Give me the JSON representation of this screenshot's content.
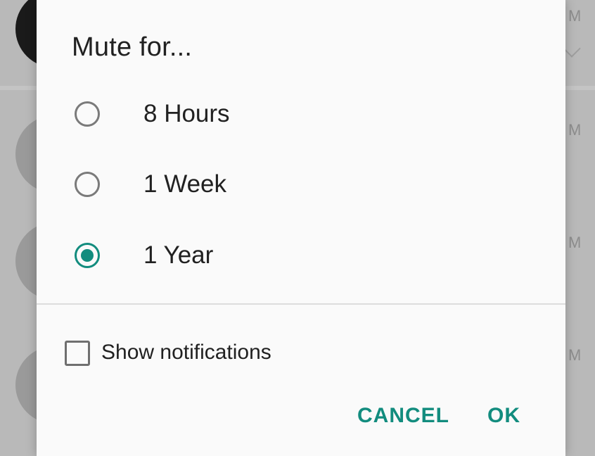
{
  "background": {
    "time_fragments": [
      "M",
      "M",
      "M",
      "M"
    ]
  },
  "dialog": {
    "title": "Mute for...",
    "options": [
      {
        "label": "8 Hours",
        "selected": false
      },
      {
        "label": "1 Week",
        "selected": false
      },
      {
        "label": "1 Year",
        "selected": true
      }
    ],
    "show_notifications": {
      "label": "Show notifications",
      "checked": false
    },
    "buttons": {
      "cancel": "CANCEL",
      "ok": "OK"
    }
  },
  "colors": {
    "accent": "#128c7e",
    "dialog_bg": "#fafafa",
    "scrim": "#b9b9b9"
  }
}
